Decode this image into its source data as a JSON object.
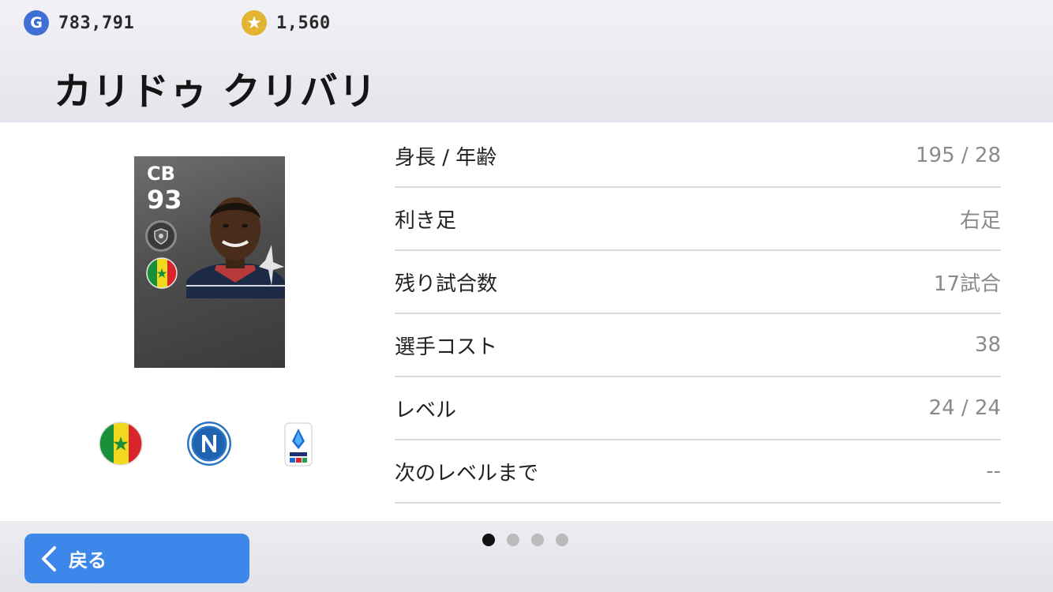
{
  "header": {
    "gp": {
      "icon": "g-coin-icon",
      "value": "783,791",
      "icon_letter": "G"
    },
    "coins": {
      "icon": "star-coin-icon",
      "value": "1,560",
      "icon_glyph": "★"
    },
    "player_name": "カリドゥ クリバリ"
  },
  "card": {
    "position": "CB",
    "rating": "93",
    "badge_icon": "club-crest-badge-icon",
    "nationality_flag": "senegal-flag-icon"
  },
  "icons": {
    "nation": "senegal-flag-icon",
    "club": "napoli-crest-icon",
    "league": "serie-a-logo-icon"
  },
  "stats": [
    {
      "label": "身長 / 年齢",
      "value": "195 / 28"
    },
    {
      "label": "利き足",
      "value": "右足"
    },
    {
      "label": "残り試合数",
      "value": "17試合"
    },
    {
      "label": "選手コスト",
      "value": "38"
    },
    {
      "label": "レベル",
      "value": "24 / 24"
    },
    {
      "label": "次のレベルまで",
      "value": "--"
    }
  ],
  "footer": {
    "back_label": "戻る",
    "pages": {
      "count": 4,
      "active": 1
    }
  },
  "colors": {
    "accent_button": "#3d86ea",
    "header_bg": "#e8e8ef",
    "value_text": "#8a8a8a"
  }
}
